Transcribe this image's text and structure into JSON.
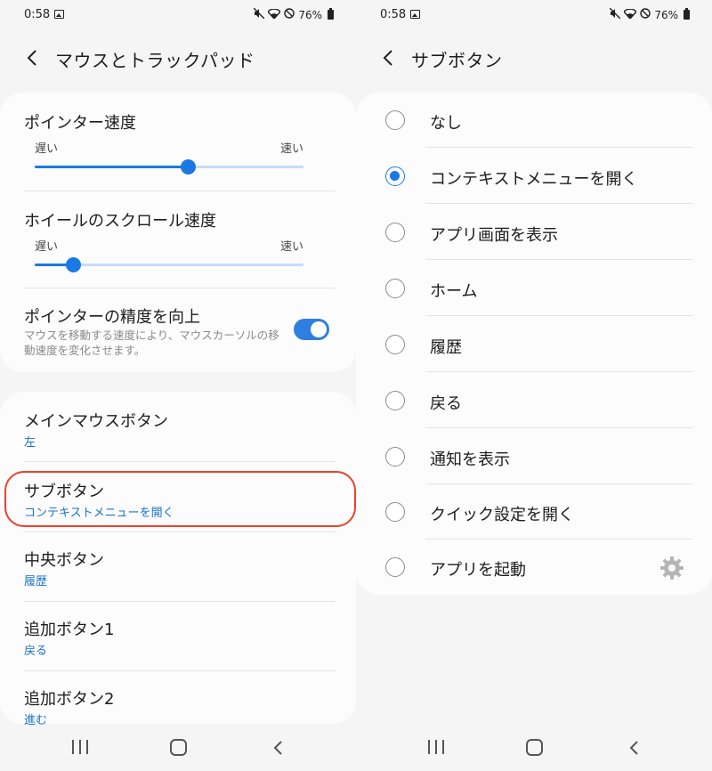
{
  "status_bar": {
    "time": "0:58",
    "battery": "76%",
    "icons": [
      "gallery-icon",
      "mute-icon",
      "wifi-icon",
      "block-icon",
      "battery-icon"
    ]
  },
  "left": {
    "header_title": "マウスとトラックパッド",
    "pointer_speed": {
      "label": "ポインター速度",
      "slow": "遅い",
      "fast": "速い",
      "value_fraction": 0.57
    },
    "scroll_speed": {
      "label": "ホイールのスクロール速度",
      "slow": "遅い",
      "fast": "速い",
      "value_fraction": 0.14
    },
    "precision": {
      "label": "ポインターの精度を向上",
      "description": "マウスを移動する速度により、マウスカーソルの移動速度を変化させます。",
      "enabled": true
    },
    "buttons": [
      {
        "label": "メインマウスボタン",
        "value": "左"
      },
      {
        "label": "サブボタン",
        "value": "コンテキストメニューを開く"
      },
      {
        "label": "中央ボタン",
        "value": "履歴"
      },
      {
        "label": "追加ボタン1",
        "value": "戻る"
      },
      {
        "label": "追加ボタン2",
        "value": "進む"
      }
    ]
  },
  "right": {
    "header_title": "サブボタン",
    "options": [
      {
        "label": "なし",
        "checked": false
      },
      {
        "label": "コンテキストメニューを開く",
        "checked": true
      },
      {
        "label": "アプリ画面を表示",
        "checked": false
      },
      {
        "label": "ホーム",
        "checked": false
      },
      {
        "label": "履歴",
        "checked": false
      },
      {
        "label": "戻る",
        "checked": false
      },
      {
        "label": "通知を表示",
        "checked": false
      },
      {
        "label": "クイック設定を開く",
        "checked": false
      },
      {
        "label": "アプリを起動",
        "checked": false
      }
    ]
  },
  "colors": {
    "accent": "#1a79e3",
    "highlight": "#e8432b",
    "link": "#1a73c9"
  }
}
